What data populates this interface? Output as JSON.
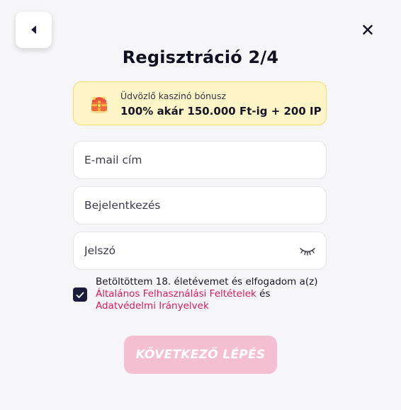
{
  "header": {
    "title": "Regisztráció 2/4",
    "back_icon": "chevron-left-icon",
    "close_icon": "close-icon"
  },
  "bonus": {
    "icon": "treasure-chest-icon",
    "subtitle": "Üdvözlő kaszinó bónusz",
    "headline": "100% akár 150.000 Ft-ig + 200 IP"
  },
  "form": {
    "email_placeholder": "E-mail cím",
    "login_placeholder": "Bejelentkezés",
    "password_placeholder": "Jelszó",
    "password_toggle_icon": "eye-closed-icon"
  },
  "consent": {
    "checked": true,
    "text_prefix": "Betöltöttem 18. életévemet és elfogadom a(z)",
    "terms_link": "Általános Felhasználási Feltételek",
    "connector": "és",
    "privacy_link": "Adatvédelmi Irányelvek"
  },
  "actions": {
    "next_label": "KÖVETKEZŐ LÉPÉS"
  },
  "colors": {
    "background": "#f6f6f8",
    "bonus_bg": "#fdf5c8",
    "bonus_border": "#f4de69",
    "link": "#e0165f",
    "button_disabled": "#f4bfd0",
    "checkbox": "#1b1b3a"
  }
}
